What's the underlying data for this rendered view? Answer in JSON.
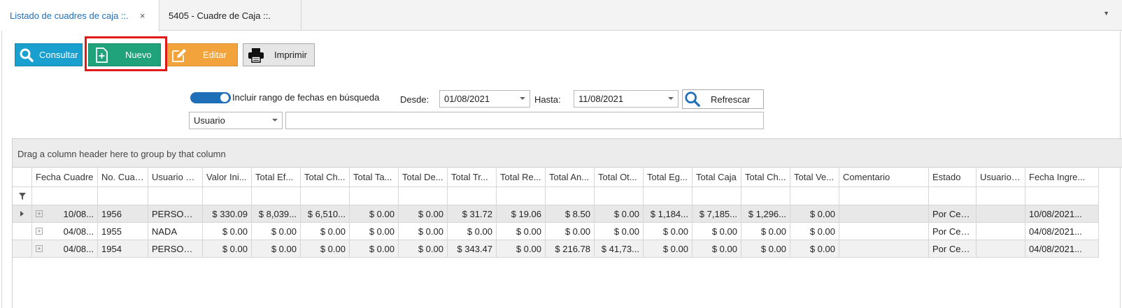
{
  "tabs": [
    {
      "label": "Listado de cuadres de caja ::.",
      "close": "×"
    },
    {
      "label": "5405 - Cuadre de Caja ::."
    }
  ],
  "toolbar": {
    "consultar": "Consultar",
    "nuevo": "Nuevo",
    "editar": "Editar",
    "imprimir": "Imprimir"
  },
  "filters": {
    "toggle_label": "Incluir rango de fechas en búsqueda",
    "desde_label": "Desde:",
    "desde_value": "01/08/2021",
    "hasta_label": "Hasta:",
    "hasta_value": "11/08/2021",
    "refrescar": "Refrescar",
    "field_select": "Usuario",
    "search_value": ""
  },
  "grid": {
    "group_hint": "Drag a column header here to group by that column",
    "columns": [
      "Fecha Cuadre",
      "No. Cuad...",
      "Usuario C...",
      "Valor Ini...",
      "Total Ef...",
      "Total Ch...",
      "Total Ta...",
      "Total De...",
      "Total Tr...",
      "Total Re...",
      "Total An...",
      "Total Ot...",
      "Total Eg...",
      "Total Caja",
      "Total Ch...",
      "Total Ve...",
      "Comentario",
      "Estado",
      "Usuario ...",
      "Fecha Ingre..."
    ],
    "rows": [
      [
        "10/08...",
        "1956",
        "PERSONA...",
        "$ 330.09",
        "$ 8,039...",
        "$ 6,510...",
        "$ 0.00",
        "$ 0.00",
        "$ 31.72",
        "$ 19.06",
        "$ 8.50",
        "$ 0.00",
        "$ 1,184...",
        "$ 7,185...",
        "$ 1,296...",
        "$ 0.00",
        "",
        "Por Cerr...",
        "",
        "10/08/2021..."
      ],
      [
        "04/08...",
        "1955",
        "NADA",
        "$ 0.00",
        "$ 0.00",
        "$ 0.00",
        "$ 0.00",
        "$ 0.00",
        "$ 0.00",
        "$ 0.00",
        "$ 0.00",
        "$ 0.00",
        "$ 0.00",
        "$ 0.00",
        "$ 0.00",
        "$ 0.00",
        "",
        "Por Cerr...",
        "",
        "04/08/2021..."
      ],
      [
        "04/08...",
        "1954",
        "PERSONA...",
        "$ 0.00",
        "$ 0.00",
        "$ 0.00",
        "$ 0.00",
        "$ 0.00",
        "$ 343.47",
        "$ 0.00",
        "$ 216.78",
        "$ 41,73...",
        "$ 0.00",
        "$ 0.00",
        "$ 0.00",
        "$ 0.00",
        "",
        "Por Cerr...",
        "",
        "04/08/2021..."
      ]
    ]
  },
  "colors": {
    "accent": "#1e6fb8",
    "consultar": "#1aa0cf",
    "nuevo": "#20a37a",
    "editar": "#f2a33b",
    "highlight": "#e01919"
  }
}
